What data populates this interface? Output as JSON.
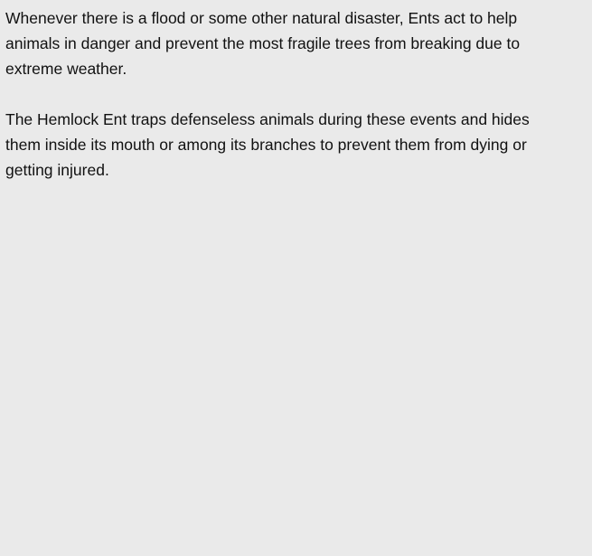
{
  "article": {
    "paragraphs": [
      "Whenever there is a flood or some other natural disaster, Ents act to help animals in danger and prevent the most fragile trees from breaking due to extreme weather.",
      "The Hemlock Ent traps defenseless animals during these events and hides them inside its mouth or among its branches to prevent them from dying or getting injured."
    ]
  }
}
